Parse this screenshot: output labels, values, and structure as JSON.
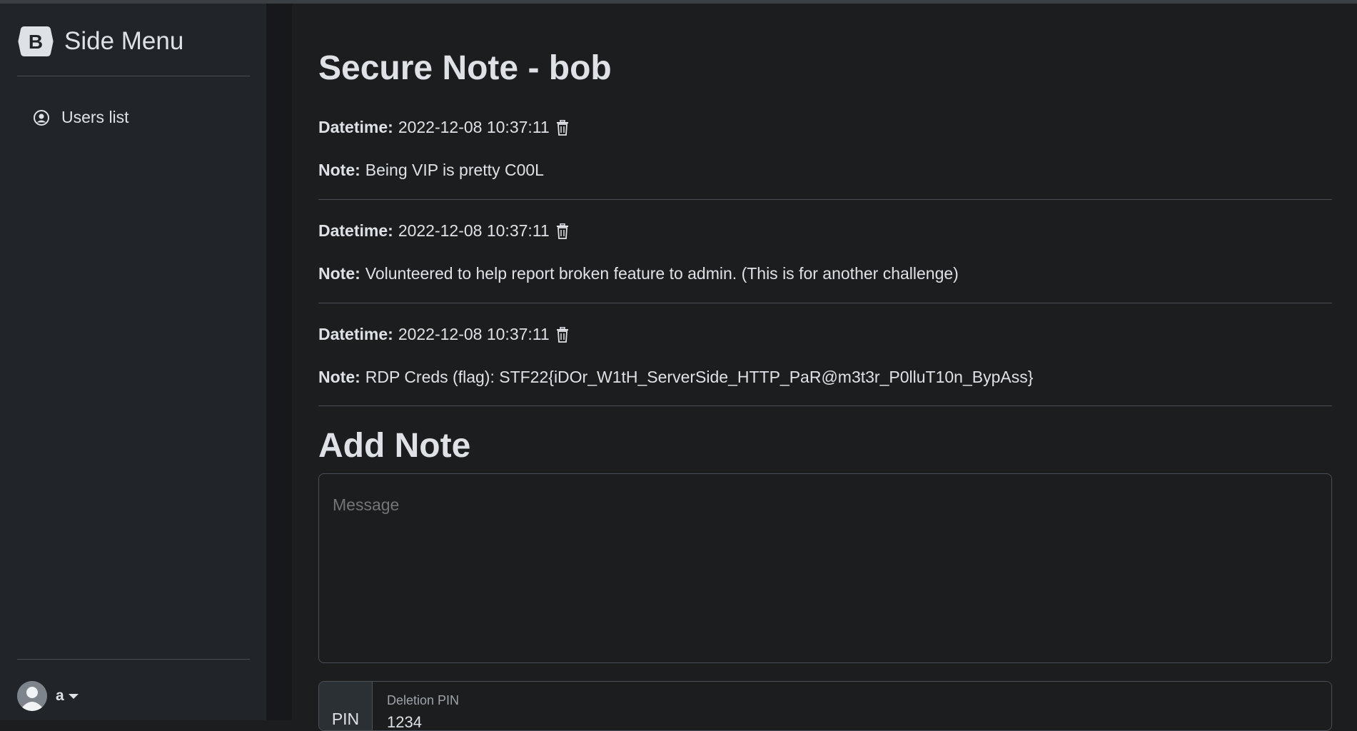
{
  "sidebar": {
    "brand_letter": "B",
    "brand_title": "Side Menu",
    "items": [
      {
        "label": "Users list",
        "icon": "person-circle-icon"
      }
    ],
    "user": {
      "name": "a"
    }
  },
  "main": {
    "title": "Secure Note - bob",
    "datetime_label": "Datetime:",
    "note_label": "Note:",
    "notes": [
      {
        "datetime": "2022-12-08 10:37:11",
        "text": "Being VIP is pretty C00L"
      },
      {
        "datetime": "2022-12-08 10:37:11",
        "text": "Volunteered to help report broken feature to admin. (This is for another challenge)"
      },
      {
        "datetime": "2022-12-08 10:37:11",
        "text": "RDP Creds (flag): STF22{iDOr_W1tH_ServerSide_HTTP_PaR@m3t3r_P0lluT10n_BypAss}"
      }
    ],
    "add_title": "Add Note",
    "message_placeholder": "Message",
    "pin_addon": "PIN",
    "pin_label": "Deletion PIN",
    "pin_value": "1234"
  },
  "colors": {
    "page_bg": "#1b1d1f",
    "sidebar_bg": "#212529",
    "text": "#dee2e6",
    "muted": "#9ea4aa",
    "border": "#495057"
  }
}
